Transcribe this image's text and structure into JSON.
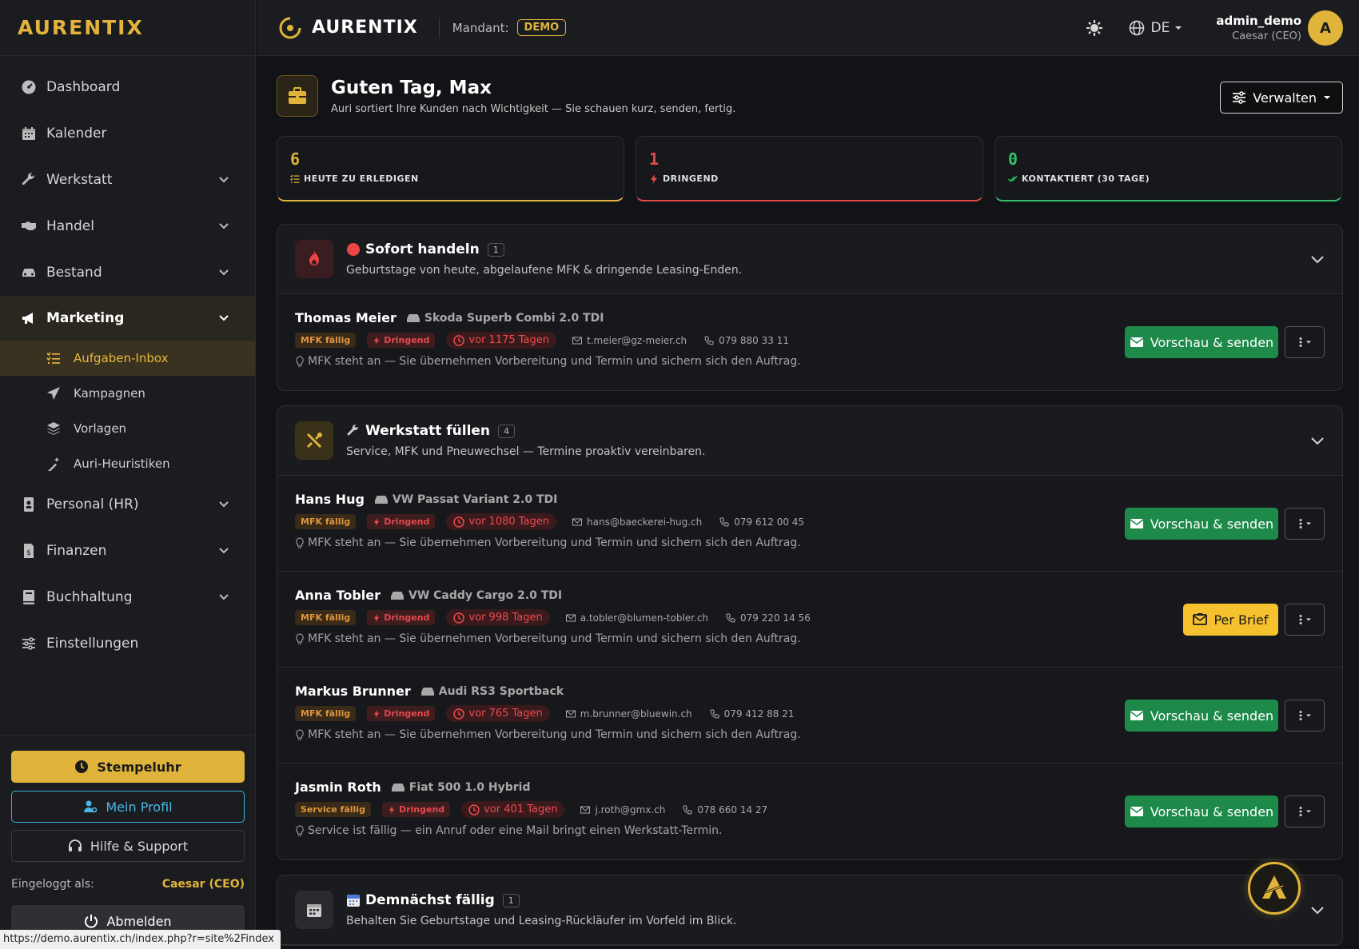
{
  "brand": "AURENTIX",
  "sidebar": {
    "items": [
      {
        "label": "Dashboard",
        "icon": "gauge-icon"
      },
      {
        "label": "Kalender",
        "icon": "calendar-icon"
      },
      {
        "label": "Werkstatt",
        "icon": "wrench-icon"
      },
      {
        "label": "Handel",
        "icon": "handshake-icon"
      },
      {
        "label": "Bestand",
        "icon": "car-icon"
      },
      {
        "label": "Marketing",
        "icon": "megaphone-icon"
      },
      {
        "label": "Personal (HR)",
        "icon": "id-badge-icon"
      },
      {
        "label": "Finanzen",
        "icon": "invoice-icon"
      },
      {
        "label": "Buchhaltung",
        "icon": "book-icon"
      },
      {
        "label": "Einstellungen",
        "icon": "sliders-icon"
      }
    ],
    "marketing_sub": [
      {
        "label": "Aufgaben-Inbox",
        "icon": "list-check-icon"
      },
      {
        "label": "Kampagnen",
        "icon": "paper-plane-icon"
      },
      {
        "label": "Vorlagen",
        "icon": "layers-icon"
      },
      {
        "label": "Auri-Heuristiken",
        "icon": "magic-wand-icon"
      }
    ],
    "stempeluhr": "Stempeluhr",
    "mein_profil": "Mein Profil",
    "hilfe": "Hilfe & Support",
    "logged_label": "Eingeloggt als:",
    "logged_user": "Caesar (CEO)",
    "abmelden": "Abmelden"
  },
  "status_url": "https://demo.aurentix.ch/index.php?r=site%2Findex",
  "topbar": {
    "logo": "AURENTIX",
    "mandant_label": "Mandant:",
    "mandant_value": "DEMO",
    "lang": "DE",
    "username": "admin_demo",
    "role": "Caesar (CEO)",
    "avatar": "A"
  },
  "header": {
    "title": "Guten Tag, Max",
    "subtitle": "Auri sortiert Ihre Kunden nach Wichtigkeit — Sie schauen kurz, senden, fertig.",
    "verwalten": "Verwalten"
  },
  "stats": [
    {
      "value": "6",
      "label": "HEUTE ZU ERLEDIGEN",
      "color": "#e0b43a"
    },
    {
      "value": "1",
      "label": "DRINGEND",
      "color": "#e24b4b"
    },
    {
      "value": "0",
      "label": "KONTAKTIERT (30 TAGE)",
      "color": "#33c069"
    }
  ],
  "sections": [
    {
      "title": "Sofort handeln",
      "count": "1",
      "subtitle": "Geburtstage von heute, abgelaufene MFK & dringende Leasing-Enden.",
      "rows": [
        {
          "name": "Thomas Meier",
          "car": "Skoda Superb Combi 2.0 TDI",
          "badge": "MFK fällig",
          "urgent": "Dringend",
          "age": "vor 1175 Tagen",
          "email": "t.meier@gz-meier.ch",
          "phone": "079 880 33 11",
          "note": "MFK steht an — Sie übernehmen Vorbereitung und Termin und sichern sich den Auftrag.",
          "action": "Vorschau & senden"
        }
      ]
    },
    {
      "title": "Werkstatt füllen",
      "count": "4",
      "subtitle": "Service, MFK und Pneuwechsel — Termine proaktiv vereinbaren.",
      "rows": [
        {
          "name": "Hans Hug",
          "car": "VW Passat Variant 2.0 TDI",
          "badge": "MFK fällig",
          "urgent": "Dringend",
          "age": "vor 1080 Tagen",
          "email": "hans@baeckerei-hug.ch",
          "phone": "079 612 00 45",
          "note": "MFK steht an — Sie übernehmen Vorbereitung und Termin und sichern sich den Auftrag.",
          "action": "Vorschau & senden"
        },
        {
          "name": "Anna Tobler",
          "car": "VW Caddy Cargo 2.0 TDI",
          "badge": "MFK fällig",
          "urgent": "Dringend",
          "age": "vor 998 Tagen",
          "email": "a.tobler@blumen-tobler.ch",
          "phone": "079 220 14 56",
          "note": "MFK steht an — Sie übernehmen Vorbereitung und Termin und sichern sich den Auftrag.",
          "action": "Per Brief"
        },
        {
          "name": "Markus Brunner",
          "car": "Audi RS3 Sportback",
          "badge": "MFK fällig",
          "urgent": "Dringend",
          "age": "vor 765 Tagen",
          "email": "m.brunner@bluewin.ch",
          "phone": "079 412 88 21",
          "note": "MFK steht an — Sie übernehmen Vorbereitung und Termin und sichern sich den Auftrag.",
          "action": "Vorschau & senden"
        },
        {
          "name": "Jasmin Roth",
          "car": "Fiat 500 1.0 Hybrid",
          "badge": "Service fällig",
          "urgent": "Dringend",
          "age": "vor 401 Tagen",
          "email": "j.roth@gmx.ch",
          "phone": "078 660 14 27",
          "note": "Service ist fällig — ein Anruf oder eine Mail bringt einen Werkstatt-Termin.",
          "action": "Vorschau & senden"
        }
      ]
    },
    {
      "title": "Demnächst fällig",
      "count": "1",
      "subtitle": "Behalten Sie Geburtstage und Leasing-Rückläufer im Vorfeld im Blick."
    }
  ],
  "colors": {
    "accent": "#e0b43a",
    "danger": "#e24b4b",
    "success": "#1e8a4a",
    "info": "#49b7e6"
  }
}
